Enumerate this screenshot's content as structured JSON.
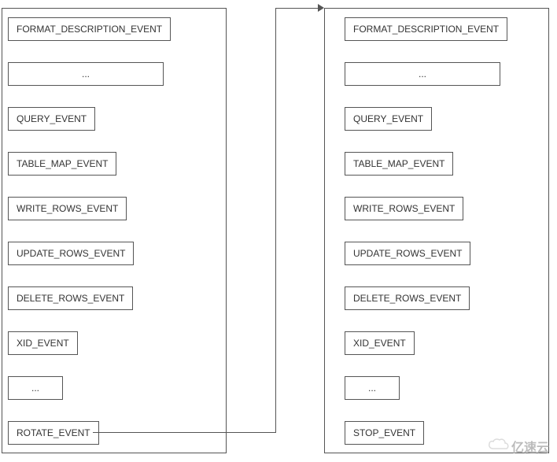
{
  "left_box": {
    "events": [
      "FORMAT_DESCRIPTION_EVENT",
      "...",
      "QUERY_EVENT",
      "TABLE_MAP_EVENT",
      "WRITE_ROWS_EVENT",
      "UPDATE_ROWS_EVENT",
      "DELETE_ROWS_EVENT",
      "XID_EVENT",
      "...",
      "ROTATE_EVENT"
    ]
  },
  "right_box": {
    "events": [
      "FORMAT_DESCRIPTION_EVENT",
      "...",
      "QUERY_EVENT",
      "TABLE_MAP_EVENT",
      "WRITE_ROWS_EVENT",
      "UPDATE_ROWS_EVENT",
      "DELETE_ROWS_EVENT",
      "XID_EVENT",
      "...",
      "STOP_EVENT"
    ]
  },
  "watermark": "亿速云",
  "arrow": {
    "from": "ROTATE_EVENT",
    "to": "right_box_top"
  }
}
